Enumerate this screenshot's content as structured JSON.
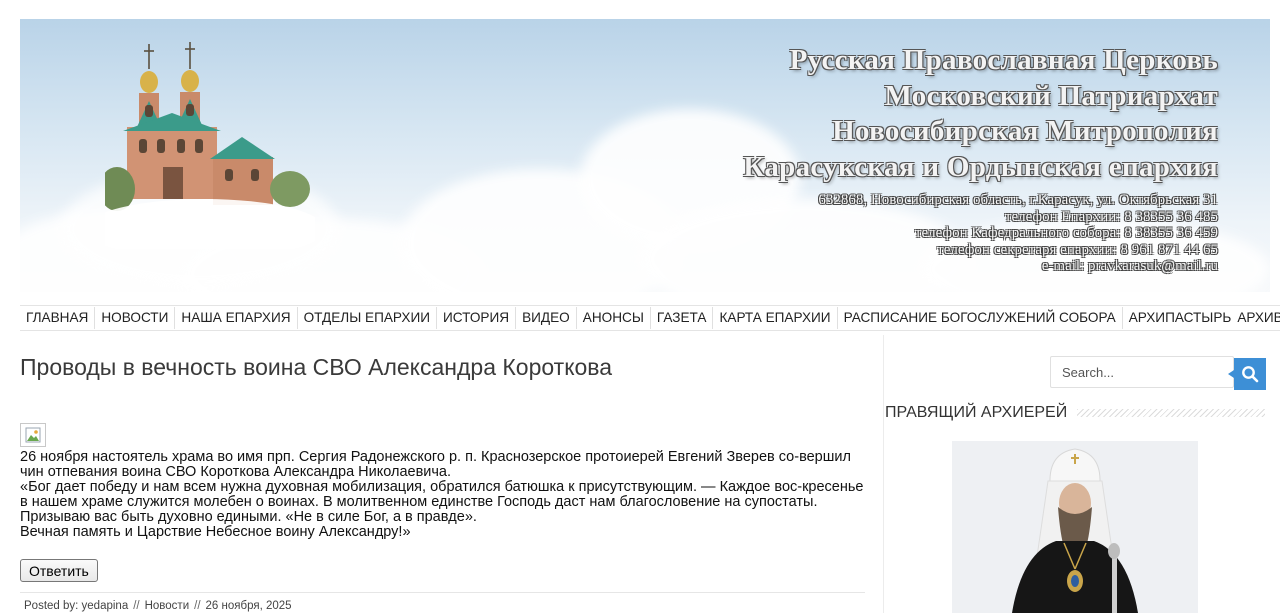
{
  "banner": {
    "titles": [
      "Русская Православная Церковь",
      "Московский Патриархат",
      "Новосибирская Митрополия",
      "Карасукская и Ордынская епархия"
    ],
    "contacts": [
      "632868, Новосибирская область, г.Карасук, ул. Октябрьская 31",
      "телефон Епархии: 8 38355 36 485",
      "телефон Кафедрального собора: 8 38355 36 459",
      "телефон секретаря епархии: 8 961 871 44 65",
      "e-mail: pravkarasuk@mail.ru"
    ]
  },
  "nav": {
    "items": [
      "ГЛАВНАЯ",
      "НОВОСТИ",
      "НАША ЕПАРХИЯ",
      "ОТДЕЛЫ ЕПАРХИИ",
      "ИСТОРИЯ",
      "ВИДЕО",
      "АНОНСЫ",
      "ГАЗЕТА",
      "КАРТА ЕПАРХИИ",
      "РАСПИСАНИЕ БОГОСЛУЖЕНИЙ СОБОРА",
      "АРХИПАСТЫРЬ",
      "АРХИВ"
    ]
  },
  "post": {
    "title": "Проводы в вечность воина СВО Александра Короткова",
    "paragraphs": [
      "26 ноября настоятель храма во имя прп. Сергия Радонежского р. п. Краснозерское  протоиерей Евгений Зверев со-вершил чин отпевания  воина СВО Короткова Александра Николаевича.",
      "«Бог дает победу и нам всем нужна духовная мобилизация, обратился батюшка к присутствующим. — Каждое вос-кресенье в нашем  храме служится молебен о воинах. В молитвенном единстве Господь даст нам благословение на супостаты. Призываю вас быть духовно едиными. «Не в силе Бог, а в правде».",
      "Вечная память и Царствие Небесное воину Александру!»"
    ],
    "reply_label": "Ответить",
    "meta": {
      "posted_by": "Posted by: yedapina",
      "separator": "//",
      "category": "Новости",
      "date": "26 ноября, 2025"
    }
  },
  "sidebar": {
    "search_placeholder": "Search...",
    "widget_title": "ПРАВЯЩИЙ АРХИЕРЕЙ"
  },
  "colors": {
    "accent": "#3d8fd6",
    "sky": "#c7dcec"
  }
}
